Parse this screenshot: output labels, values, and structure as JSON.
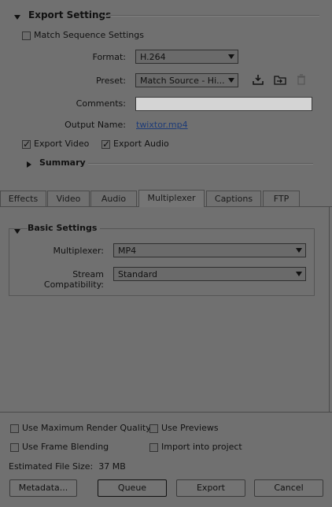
{
  "export_settings": {
    "title": "Export Settings",
    "match_sequence_label": "Match Sequence Settings",
    "match_sequence_checked": false,
    "format_label": "Format:",
    "format_value": "H.264",
    "preset_label": "Preset:",
    "preset_value": "Match Source - Hi...",
    "comments_label": "Comments:",
    "comments_value": "",
    "output_name_label": "Output Name:",
    "output_name_value": "twixtor.mp4",
    "export_video_label": "Export Video",
    "export_video_checked": true,
    "export_audio_label": "Export Audio",
    "export_audio_checked": true,
    "summary_label": "Summary"
  },
  "preset_icons": [
    "save-preset-icon",
    "import-preset-icon",
    "delete-preset-icon"
  ],
  "tabs": [
    {
      "label": "Effects",
      "active": false
    },
    {
      "label": "Video",
      "active": false
    },
    {
      "label": "Audio",
      "active": false
    },
    {
      "label": "Multiplexer",
      "active": true
    },
    {
      "label": "Captions",
      "active": false
    },
    {
      "label": "FTP",
      "active": false
    }
  ],
  "basic_settings": {
    "title": "Basic Settings",
    "multiplexer_label": "Multiplexer:",
    "multiplexer_value": "MP4",
    "stream_label": "Stream Compatibility:",
    "stream_value": "Standard"
  },
  "bottom": {
    "max_render_label": "Use Maximum Render Quality",
    "use_previews_label": "Use Previews",
    "frame_blending_label": "Use Frame Blending",
    "import_project_label": "Import into project",
    "estimated_size": "Estimated File Size:  37 MB"
  },
  "buttons": {
    "metadata": "Metadata...",
    "queue": "Queue",
    "export": "Export",
    "cancel": "Cancel"
  },
  "colors": {
    "background": "#707070",
    "link": "#1e3c78",
    "field": "#d4d4d4"
  }
}
